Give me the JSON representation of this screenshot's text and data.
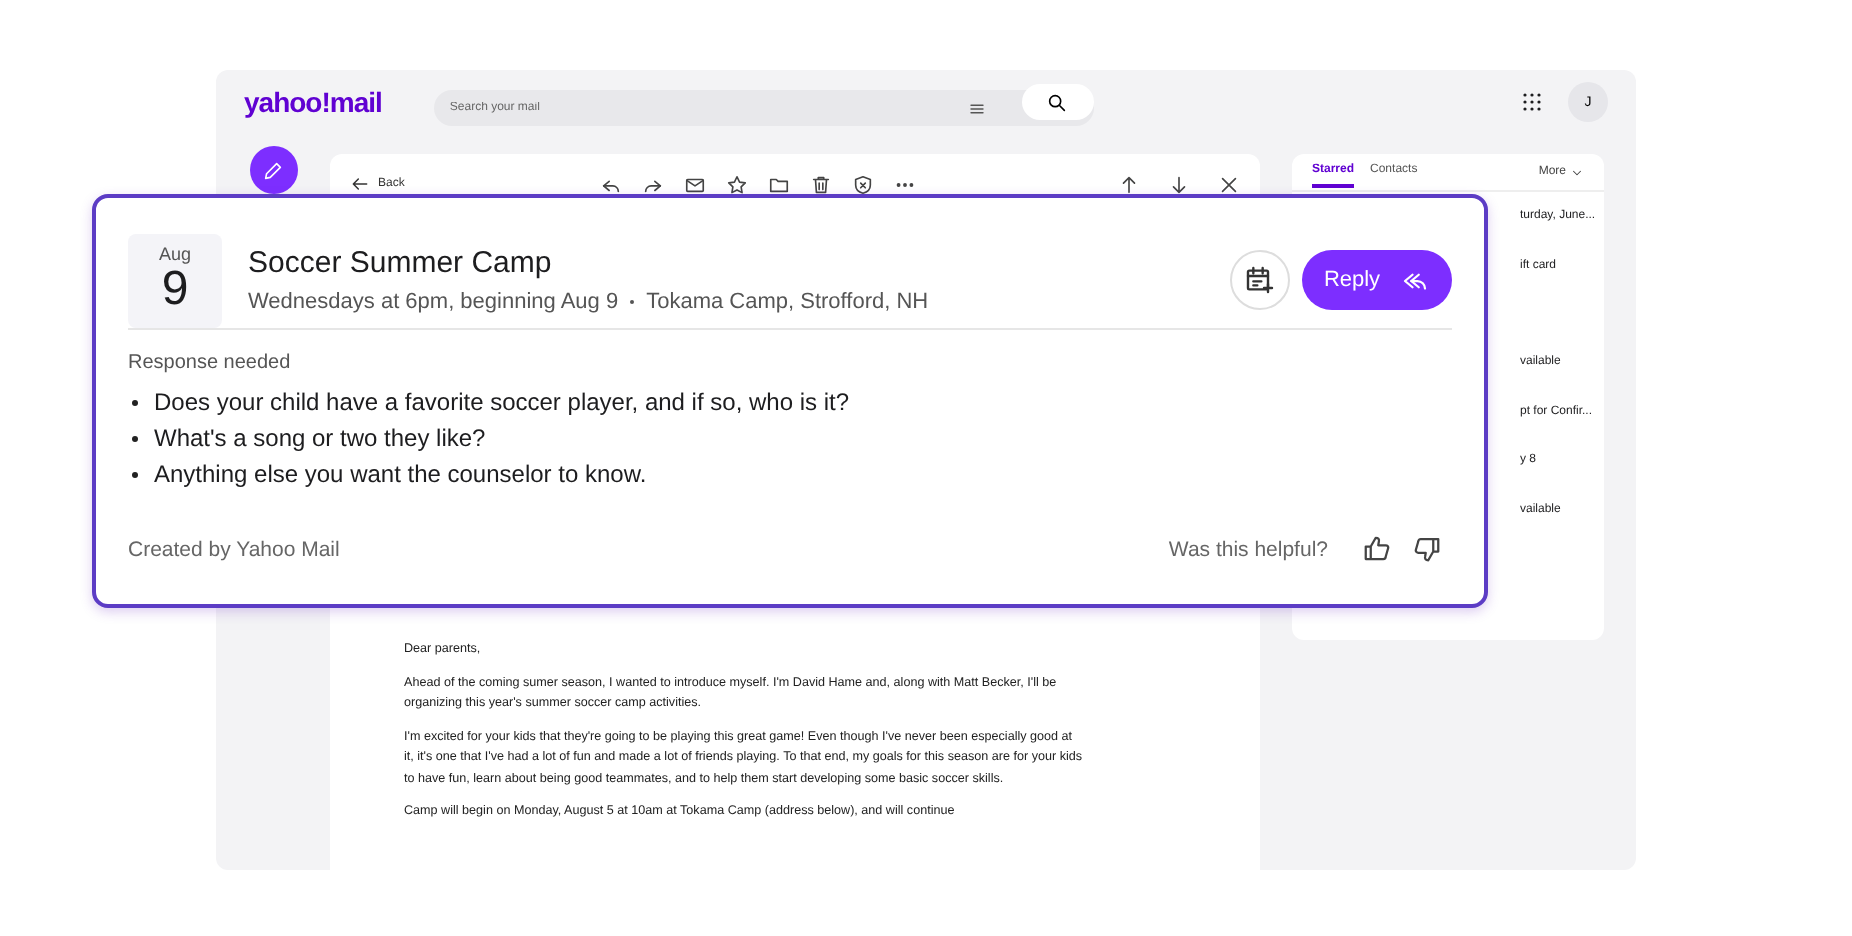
{
  "header": {
    "logo": "yahoo!mail",
    "search": {
      "placeholder": "Search your mail"
    },
    "avatar": "J"
  },
  "toolbar": {
    "back": "Back"
  },
  "right_panel": {
    "tabs": [
      {
        "label": "Starred",
        "selected": true
      },
      {
        "label": "Contacts",
        "selected": false
      }
    ],
    "more": "More",
    "items": [
      "turday, June...",
      "ift card",
      "vailable",
      "pt for Confir...",
      "y 8",
      "vailable"
    ]
  },
  "email_body": [
    "Dear parents,",
    "Ahead of the coming sumer season, I wanted to introduce myself. I'm David Hame and, along with Matt Becker, I'll be organizing this year's summer soccer camp activities.",
    "I'm excited for your kids that they're going to be playing this great game! Even though I've never been especially good at it, it's one that I've had a lot of fun and made a lot of friends playing. To that end, my goals for this season are for your kids to have fun, learn about being good teammates, and to help them start developing some basic soccer skills.",
    "Camp will begin on Monday, August 5 at 10am at Tokama Camp (address below), and will continue"
  ],
  "event_card": {
    "month": "Aug",
    "day": "9",
    "title": "Soccer Summer Camp",
    "when": "Wednesdays at 6pm, beginning Aug 9",
    "where": "Tokama Camp, Strofford, NH",
    "reply": "Reply",
    "section_label": "Response needed",
    "questions": [
      "Does your child have a favorite soccer player, and if so, who is it?",
      "What's a song or two they like?",
      "Anything else you want the counselor to know."
    ],
    "footer": "Created by Yahoo Mail",
    "feedback": "Was this helpful?"
  }
}
